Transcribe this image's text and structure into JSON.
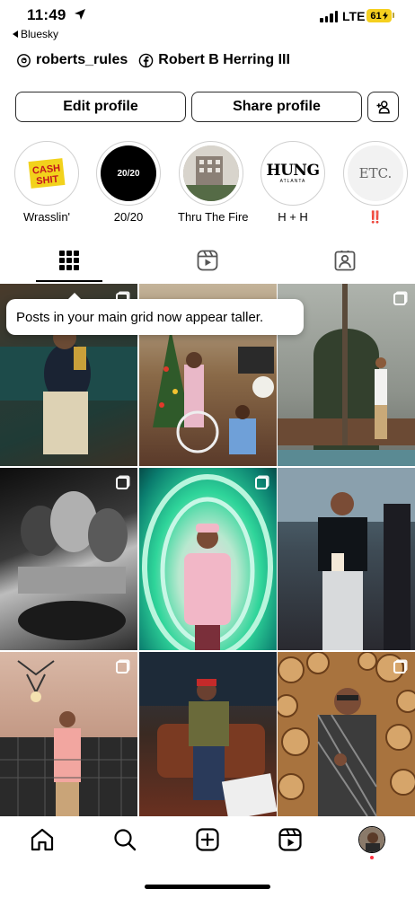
{
  "status_bar": {
    "time": "11:49",
    "back_app": "Bluesky",
    "network": "LTE",
    "battery": "61"
  },
  "links": [
    {
      "icon": "threads-icon",
      "label": "roberts_rules"
    },
    {
      "icon": "facebook-icon",
      "label": "Robert B Herring III"
    }
  ],
  "buttons": {
    "edit_profile": "Edit profile",
    "share_profile": "Share profile"
  },
  "highlights": [
    {
      "label": "Wrasslin'",
      "cover_text": "CASH SHIT"
    },
    {
      "label": "20/20",
      "cover_text": "20/20"
    },
    {
      "label": "Thru The Fire",
      "cover_text": ""
    },
    {
      "label": "H + H",
      "cover_text": "HUNG",
      "cover_subtext": "ATLANTA"
    },
    {
      "label": "‼️",
      "cover_text": "ETC."
    }
  ],
  "tabs": [
    "grid-icon",
    "reels-icon",
    "tagged-icon"
  ],
  "tooltip": "Posts in your main grid now appear taller.",
  "bottom_nav": [
    "home-icon",
    "search-icon",
    "create-icon",
    "reels-icon",
    "profile-avatar"
  ],
  "colors": {
    "battery": "#f5d01f",
    "notification_dot": "#ff3040",
    "red_emoji": "#e0201c"
  }
}
